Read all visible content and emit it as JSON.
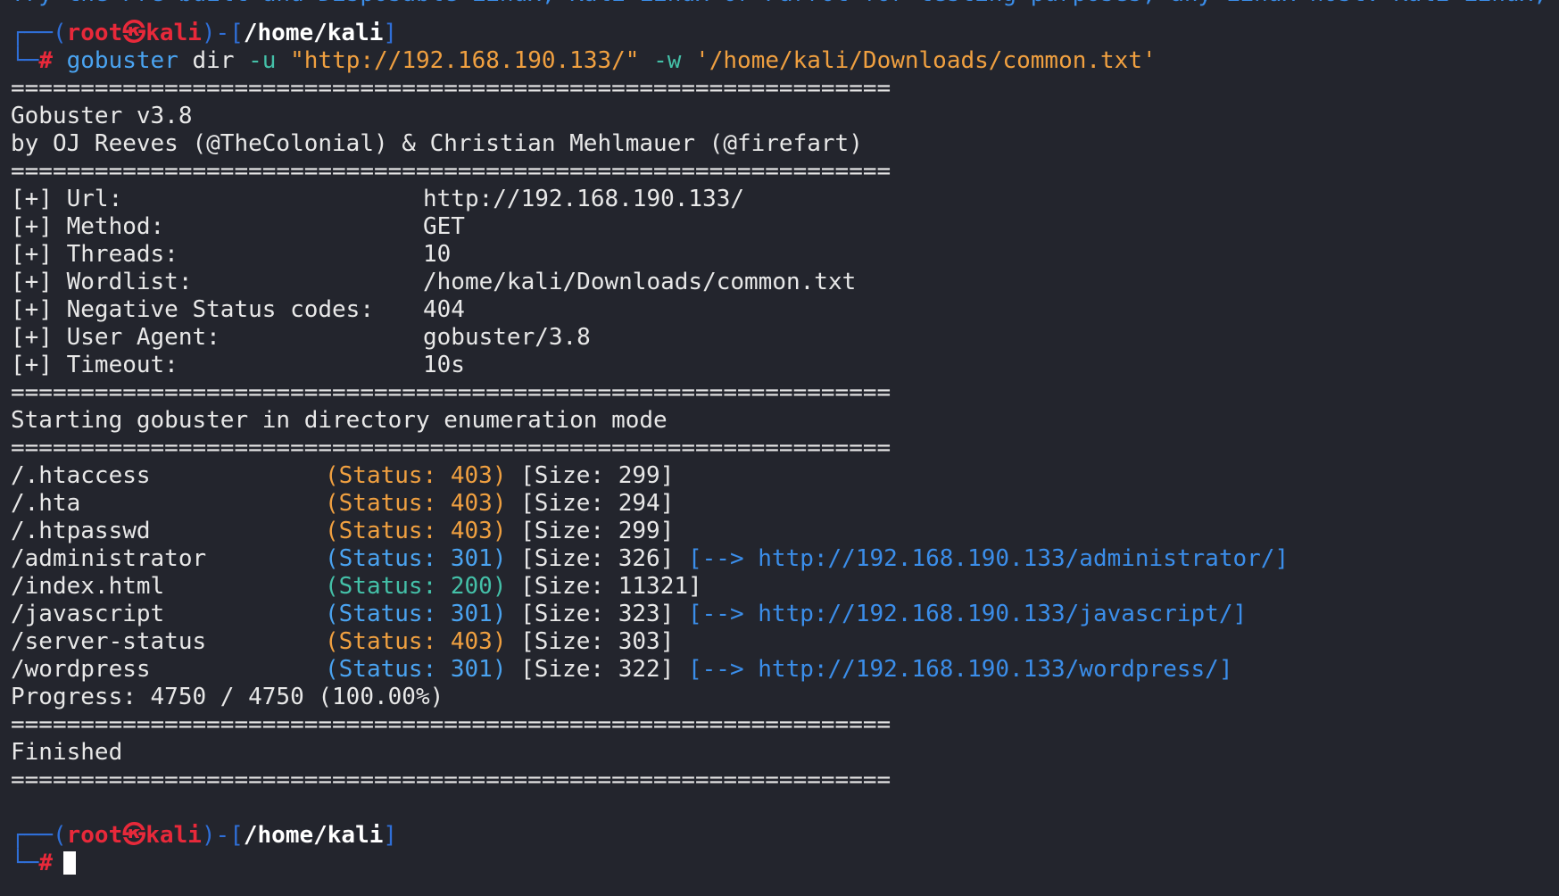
{
  "top_clipped_text": "Try the Pre-built and Disposable Linux, Kali Linux or Parrot for testing purposes, any Linux host: Kali Linux, Kali Linux Purple",
  "prompt1": {
    "open": "┌──(",
    "user": "root",
    "skull": "㉿",
    "host": "kali",
    "mid": ")-[",
    "path": "/home/kali",
    "close": "]",
    "corner": "└─",
    "hash": "#"
  },
  "command": {
    "program": "gobuster",
    "sub": "dir",
    "flag_u": "-u",
    "url": "\"http://192.168.190.133/\"",
    "flag_w": "-w",
    "wordlist": "'/home/kali/Downloads/common.txt'"
  },
  "separator": "===============================================================",
  "banner": {
    "version": "Gobuster v3.8",
    "authors": "by OJ Reeves (@TheColonial) & Christian Mehlmauer (@firefart)"
  },
  "config": [
    {
      "label": "[+] Url:",
      "value": "http://192.168.190.133/"
    },
    {
      "label": "[+] Method:",
      "value": "GET"
    },
    {
      "label": "[+] Threads:",
      "value": "10"
    },
    {
      "label": "[+] Wordlist:",
      "value": "/home/kali/Downloads/common.txt"
    },
    {
      "label": "[+] Negative Status codes:",
      "value": "404"
    },
    {
      "label": "[+] User Agent:",
      "value": "gobuster/3.8"
    },
    {
      "label": "[+] Timeout:",
      "value": "10s"
    }
  ],
  "start_message": "Starting gobuster in directory enumeration mode",
  "results": [
    {
      "path": "/.htaccess",
      "status": "(Status: 403)",
      "code": "403",
      "size": "[Size: 299]",
      "redirect": ""
    },
    {
      "path": "/.hta",
      "status": "(Status: 403)",
      "code": "403",
      "size": "[Size: 294]",
      "redirect": ""
    },
    {
      "path": "/.htpasswd",
      "status": "(Status: 403)",
      "code": "403",
      "size": "[Size: 299]",
      "redirect": ""
    },
    {
      "path": "/administrator",
      "status": "(Status: 301)",
      "code": "301",
      "size": "[Size: 326]",
      "redirect": "[--> http://192.168.190.133/administrator/]"
    },
    {
      "path": "/index.html",
      "status": "(Status: 200)",
      "code": "200",
      "size": "[Size: 11321]",
      "redirect": ""
    },
    {
      "path": "/javascript",
      "status": "(Status: 301)",
      "code": "301",
      "size": "[Size: 323]",
      "redirect": "[--> http://192.168.190.133/javascript/]"
    },
    {
      "path": "/server-status",
      "status": "(Status: 403)",
      "code": "403",
      "size": "[Size: 303]",
      "redirect": ""
    },
    {
      "path": "/wordpress",
      "status": "(Status: 301)",
      "code": "301",
      "size": "[Size: 322]",
      "redirect": "[--> http://192.168.190.133/wordpress/]"
    }
  ],
  "progress": "Progress: 4750 / 4750 (100.00%)",
  "finished": "Finished",
  "prompt2": {
    "open": "┌──(",
    "user": "root",
    "skull": "㉿",
    "host": "kali",
    "mid": ")-[",
    "path": "/home/kali",
    "close": "]",
    "corner": "└─",
    "hash": "#"
  },
  "colors": {
    "background": "#23252d",
    "prompt_red": "#e8293a",
    "prompt_blue": "#2f6fd8",
    "command_blue": "#4aa3f0",
    "flag_teal": "#44c0a8",
    "string_orange": "#f0a040",
    "redirect_blue": "#3b8eea"
  }
}
